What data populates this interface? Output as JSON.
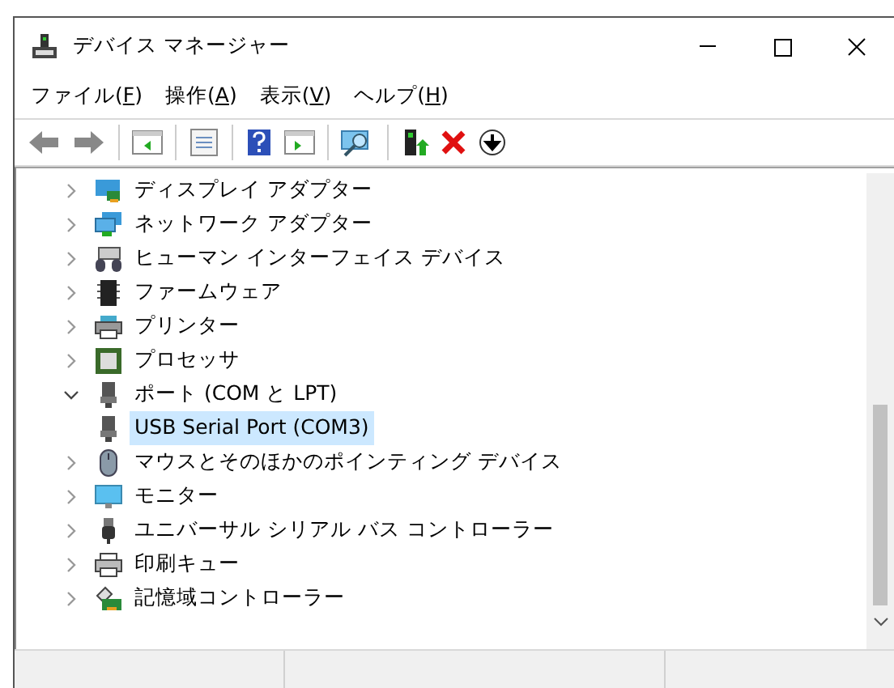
{
  "window": {
    "title": "デバイス マネージャー"
  },
  "menu": [
    "ファイル(F)",
    "操作(A)",
    "表示(V)",
    "ヘルプ(H)"
  ],
  "tree": [
    {
      "label": "ディスプレイ アダプター",
      "expanded": false,
      "selected": false
    },
    {
      "label": "ネットワーク アダプター",
      "expanded": false,
      "selected": false
    },
    {
      "label": "ヒューマン インターフェイス デバイス",
      "expanded": false,
      "selected": false
    },
    {
      "label": "ファームウェア",
      "expanded": false,
      "selected": false
    },
    {
      "label": "プリンター",
      "expanded": false,
      "selected": false
    },
    {
      "label": "プロセッサ",
      "expanded": false,
      "selected": false
    },
    {
      "label": "ポート (COM と LPT)",
      "expanded": true,
      "selected": false,
      "children": [
        {
          "label": "USB Serial Port (COM3)",
          "selected": true
        }
      ]
    },
    {
      "label": "マウスとそのほかのポインティング デバイス",
      "expanded": false,
      "selected": false
    },
    {
      "label": "モニター",
      "expanded": false,
      "selected": false
    },
    {
      "label": "ユニバーサル シリアル バス コントローラー",
      "expanded": false,
      "selected": false
    },
    {
      "label": "印刷キュー",
      "expanded": false,
      "selected": false
    },
    {
      "label": "記憶域コントローラー",
      "expanded": false,
      "selected": false
    }
  ]
}
